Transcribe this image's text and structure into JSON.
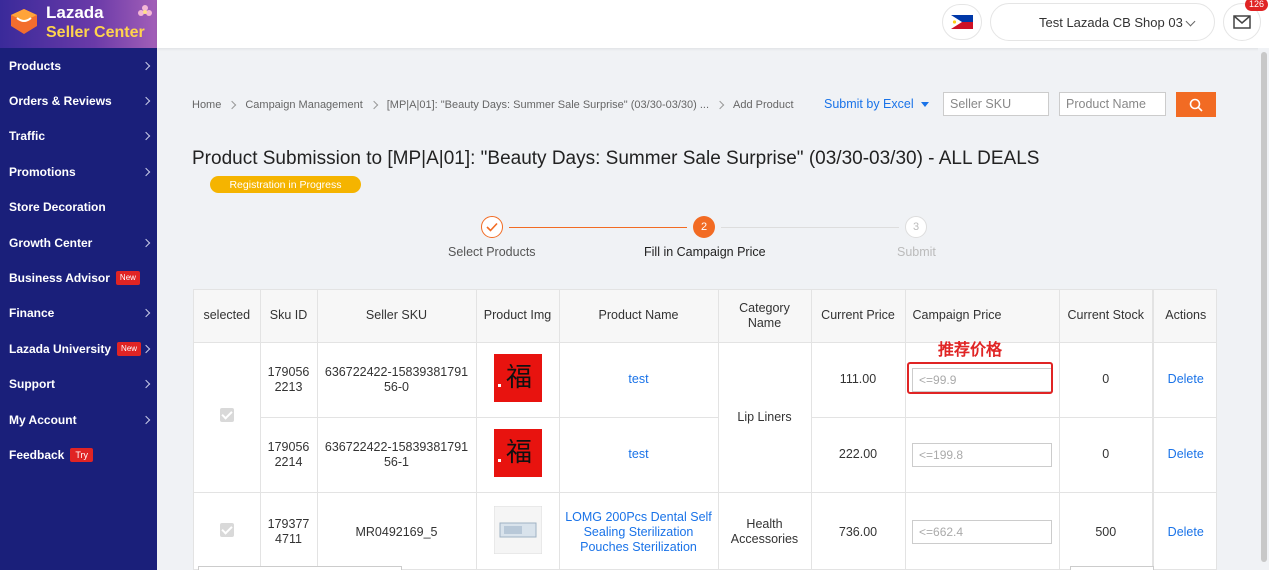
{
  "brand": {
    "line1": "Lazada",
    "line2": "Seller Center"
  },
  "colors": {
    "sidebar": "#1a1f7a",
    "accent": "#f26b23",
    "link": "#1a73e8",
    "highlight": "#e02424",
    "pill": "#f5b400"
  },
  "sidebar": {
    "items": [
      {
        "label": "Products",
        "badge": "",
        "chevron": true
      },
      {
        "label": "Orders & Reviews",
        "badge": "",
        "chevron": true
      },
      {
        "label": "Traffic",
        "badge": "",
        "chevron": true
      },
      {
        "label": "Promotions",
        "badge": "",
        "chevron": true
      },
      {
        "label": "Store Decoration",
        "badge": "",
        "chevron": false
      },
      {
        "label": "Growth Center",
        "badge": "",
        "chevron": true
      },
      {
        "label": "Business Advisor",
        "badge": "New",
        "chevron": false
      },
      {
        "label": "Finance",
        "badge": "",
        "chevron": true
      },
      {
        "label": "Lazada University",
        "badge": "New",
        "chevron": true
      },
      {
        "label": "Support",
        "badge": "",
        "chevron": true
      },
      {
        "label": "My Account",
        "badge": "",
        "chevron": true
      },
      {
        "label": "Feedback",
        "badge": "Try",
        "chevron": false
      }
    ]
  },
  "header": {
    "shop_name": "Test Lazada CB Shop 03",
    "mail_count": "126"
  },
  "breadcrumb": [
    "Home",
    "Campaign Management",
    "[MP|A|01]: \"Beauty Days: Summer Sale Surprise\" (03/30-03/30) ...",
    "Add Product"
  ],
  "toolbar": {
    "submit_excel": "Submit by Excel",
    "seller_sku_placeholder": "Seller SKU",
    "product_name_placeholder": "Product Name"
  },
  "page": {
    "title": "Product Submission to [MP|A|01]: \"Beauty Days: Summer Sale Surprise\" (03/30-03/30) - ALL DEALS",
    "status": "Registration in Progress"
  },
  "steps": [
    {
      "label": "Select Products",
      "number": "1",
      "state": "done"
    },
    {
      "label": "Fill in Campaign Price",
      "number": "2",
      "state": "active"
    },
    {
      "label": "Submit",
      "number": "3",
      "state": "pending"
    }
  ],
  "table": {
    "headers": [
      "selected",
      "Sku ID",
      "Seller SKU",
      "Product Img",
      "Product Name",
      "Category Name",
      "Current Price",
      "Campaign Price",
      "Current Stock",
      "Actions"
    ],
    "rows": [
      {
        "sku_id": "1790562213",
        "seller_sku": "636722422-1583938179156-0",
        "product_name": "test",
        "category": "Lip Liners",
        "price": "111.00",
        "campaign_placeholder": "<=99.9",
        "stock": "0",
        "action": "Delete"
      },
      {
        "sku_id": "1790562214",
        "seller_sku": "636722422-1583938179156-1",
        "product_name": "test",
        "category": "Lip Liners",
        "price": "222.00",
        "campaign_placeholder": "<=199.8",
        "stock": "0",
        "action": "Delete"
      },
      {
        "sku_id": "1793774711",
        "seller_sku": "MR0492169_5",
        "product_name": "LOMG 200Pcs Dental Self Sealing Sterilization Pouches Sterilization",
        "category": "Health Accessories",
        "price": "736.00",
        "campaign_placeholder": "<=662.4",
        "stock": "500",
        "action": "Delete"
      }
    ]
  },
  "annotation": {
    "label": "推荐价格"
  }
}
